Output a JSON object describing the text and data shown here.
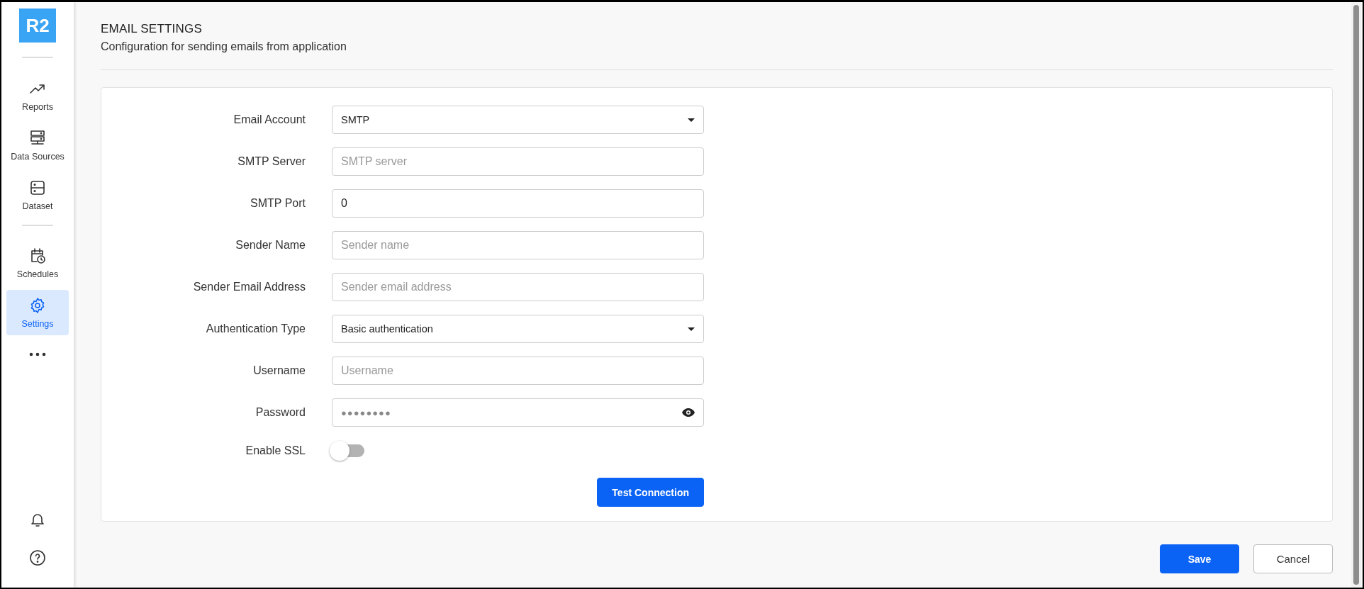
{
  "sidebar": {
    "logo": "R2",
    "items": [
      {
        "kind": "nav",
        "label": "Reports",
        "selected": false
      },
      {
        "kind": "nav",
        "label": "Data Sources",
        "selected": false
      },
      {
        "kind": "nav",
        "label": "Dataset",
        "selected": false
      },
      {
        "kind": "divider"
      },
      {
        "kind": "nav",
        "label": "Schedules",
        "selected": false
      },
      {
        "kind": "nav",
        "label": "Settings",
        "selected": true
      },
      {
        "kind": "more"
      }
    ]
  },
  "header": {
    "title": "EMAIL SETTINGS",
    "subtitle": "Configuration for sending emails from application"
  },
  "form": {
    "fields": [
      {
        "kind": "select",
        "label": "Email Account",
        "value": "SMTP"
      },
      {
        "kind": "text",
        "label": "SMTP Server",
        "placeholder": "SMTP server"
      },
      {
        "kind": "text",
        "label": "SMTP Port",
        "value": "0"
      },
      {
        "kind": "text",
        "label": "Sender Name",
        "placeholder": "Sender name"
      },
      {
        "kind": "text",
        "label": "Sender Email Address",
        "placeholder": "Sender email address"
      },
      {
        "kind": "select",
        "label": "Authentication Type",
        "value": "Basic authentication"
      },
      {
        "kind": "text",
        "label": "Username",
        "placeholder": "Username"
      },
      {
        "kind": "password",
        "label": "Password",
        "value": "●●●●●●●●"
      },
      {
        "kind": "toggle",
        "label": "Enable SSL",
        "on": false
      }
    ],
    "test_button": "Test Connection"
  },
  "actions": [
    {
      "kind": "primary",
      "label": "Save"
    },
    {
      "kind": "secondary",
      "label": "Cancel"
    }
  ]
}
